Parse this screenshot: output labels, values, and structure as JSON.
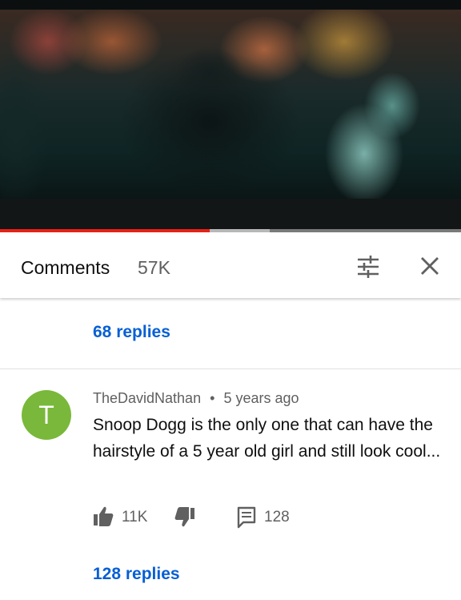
{
  "video": {
    "progress_played_fraction": 0.455,
    "progress_buffered_fraction": 0.585
  },
  "header": {
    "title": "Comments",
    "count": "57K",
    "sort_icon": "sort-sliders-icon",
    "close_icon": "close-icon"
  },
  "thread_above": {
    "replies_label": "68 replies"
  },
  "comment": {
    "avatar_letter": "T",
    "avatar_color": "#79b83a",
    "author": "TheDavidNathan",
    "separator": "•",
    "time": "5 years ago",
    "text": "Snoop Dogg is the only one that can have the hairstyle of a 5 year old girl and still look cool...",
    "like_icon": "thumbs-up-icon",
    "likes": "11K",
    "dislike_icon": "thumbs-down-icon",
    "reply_icon": "comment-icon",
    "reply_count": "128",
    "replies_label": "128 replies"
  },
  "colors": {
    "link_blue": "#065fd4",
    "progress_red": "#e62117"
  }
}
